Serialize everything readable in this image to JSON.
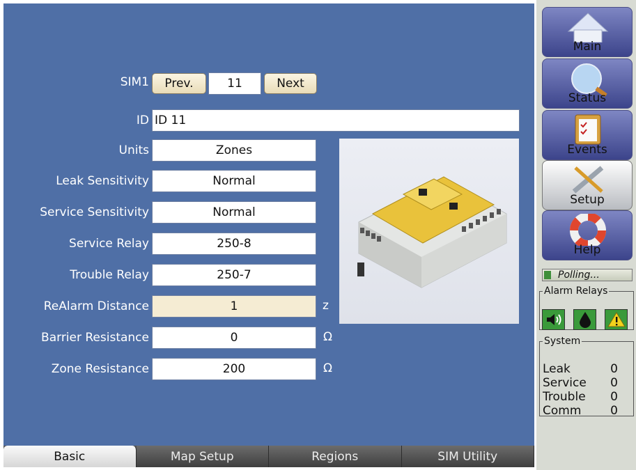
{
  "sim": {
    "label": "SIM1",
    "prev_label": "Prev.",
    "number": "11",
    "next_label": "Next"
  },
  "id_field": {
    "label": "ID",
    "value": "ID 11"
  },
  "fields": [
    {
      "label": "Units",
      "value": "Zones",
      "unit": ""
    },
    {
      "label": "Leak Sensitivity",
      "value": "Normal",
      "unit": ""
    },
    {
      "label": "Service Sensitivity",
      "value": "Normal",
      "unit": ""
    },
    {
      "label": "Service Relay",
      "value": "250-8",
      "unit": ""
    },
    {
      "label": "Trouble Relay",
      "value": "250-7",
      "unit": ""
    },
    {
      "label": "ReAlarm Distance",
      "value": "1",
      "unit": "z"
    },
    {
      "label": "Barrier Resistance",
      "value": "0",
      "unit": "Ω"
    },
    {
      "label": "Zone Resistance",
      "value": "200",
      "unit": "Ω"
    }
  ],
  "tabs": [
    "Basic",
    "Map Setup",
    "Regions",
    "SIM Utility"
  ],
  "nav": [
    "Main",
    "Status",
    "Events",
    "Setup",
    "Help"
  ],
  "polling": "Polling...",
  "alarm_relays": {
    "title": "Alarm Relays",
    "icons": [
      "speaker-icon",
      "water-drop-icon",
      "warning-icon"
    ]
  },
  "system": {
    "title": "System",
    "rows": [
      {
        "label": "Leak",
        "value": "0"
      },
      {
        "label": "Service",
        "value": "0"
      },
      {
        "label": "Trouble",
        "value": "0"
      },
      {
        "label": "Comm",
        "value": "0"
      }
    ]
  },
  "colors": {
    "panel": "#4f6fa6",
    "sidebar": "#d8dbd3",
    "nav": "#3c448b",
    "highlight_field": "#f5ecd3"
  }
}
